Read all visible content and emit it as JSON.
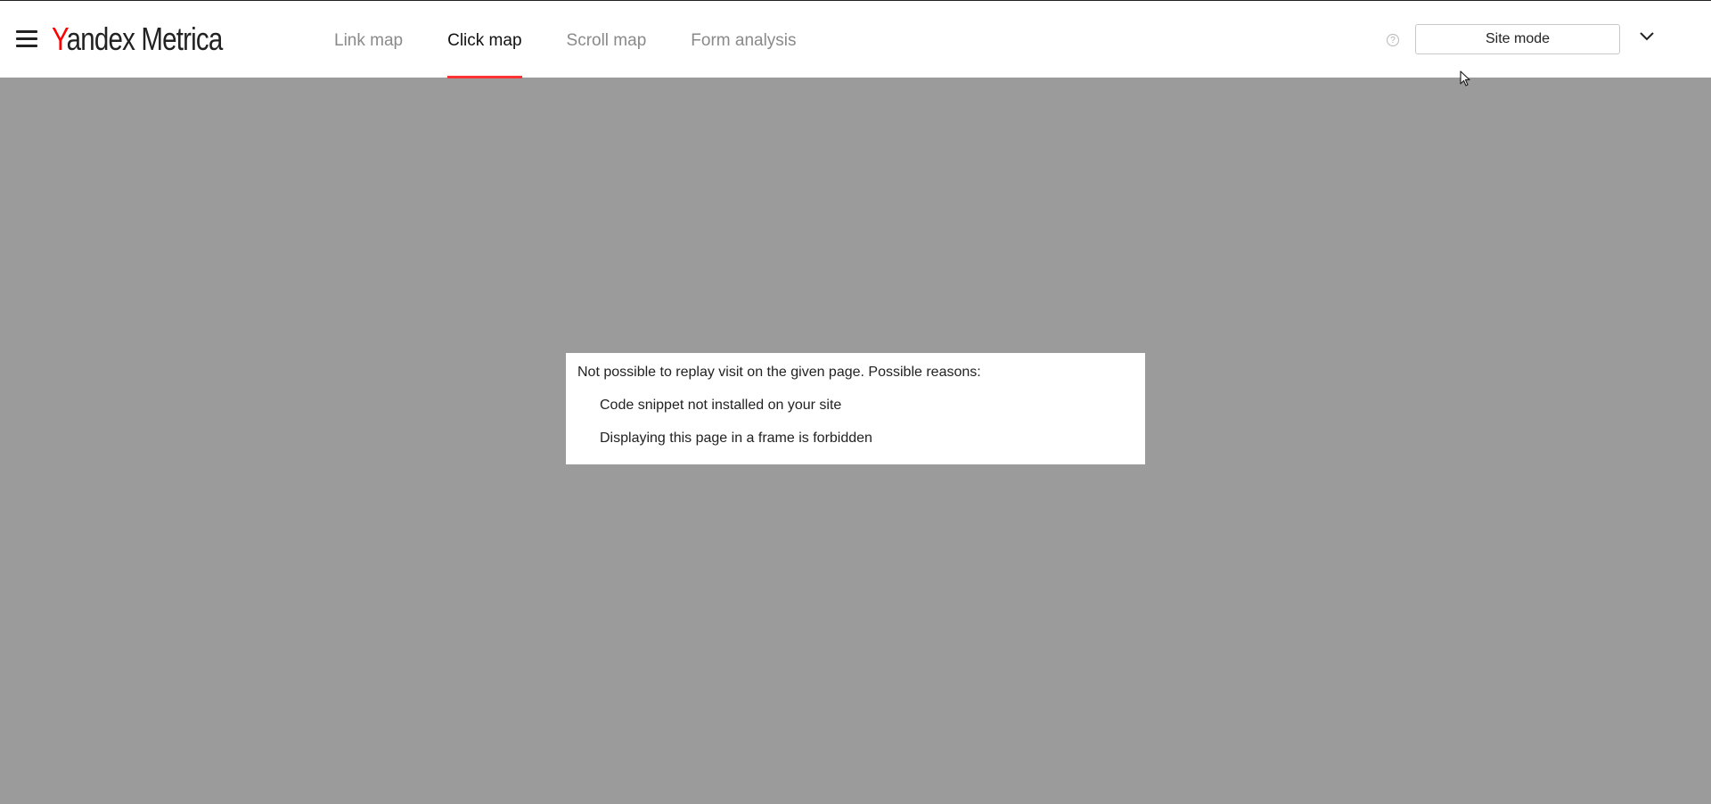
{
  "header": {
    "logo_prefix": "Y",
    "logo_rest": "andex Metrica",
    "tabs": [
      {
        "label": "Link map",
        "active": false
      },
      {
        "label": "Click map",
        "active": true
      },
      {
        "label": "Scroll map",
        "active": false
      },
      {
        "label": "Form analysis",
        "active": false
      }
    ],
    "help_icon": "?",
    "mode_select": "Site mode",
    "accent_color": "#ff3333"
  },
  "icons": {
    "menu": "hamburger-icon",
    "help": "question-circle-icon",
    "expand": "chevron-down-icon"
  },
  "dialog": {
    "message": "Not possible to replay visit on the given page. Possible reasons:",
    "reasons": [
      "Code snippet not installed on your site",
      "Displaying this page in a frame is forbidden"
    ]
  }
}
